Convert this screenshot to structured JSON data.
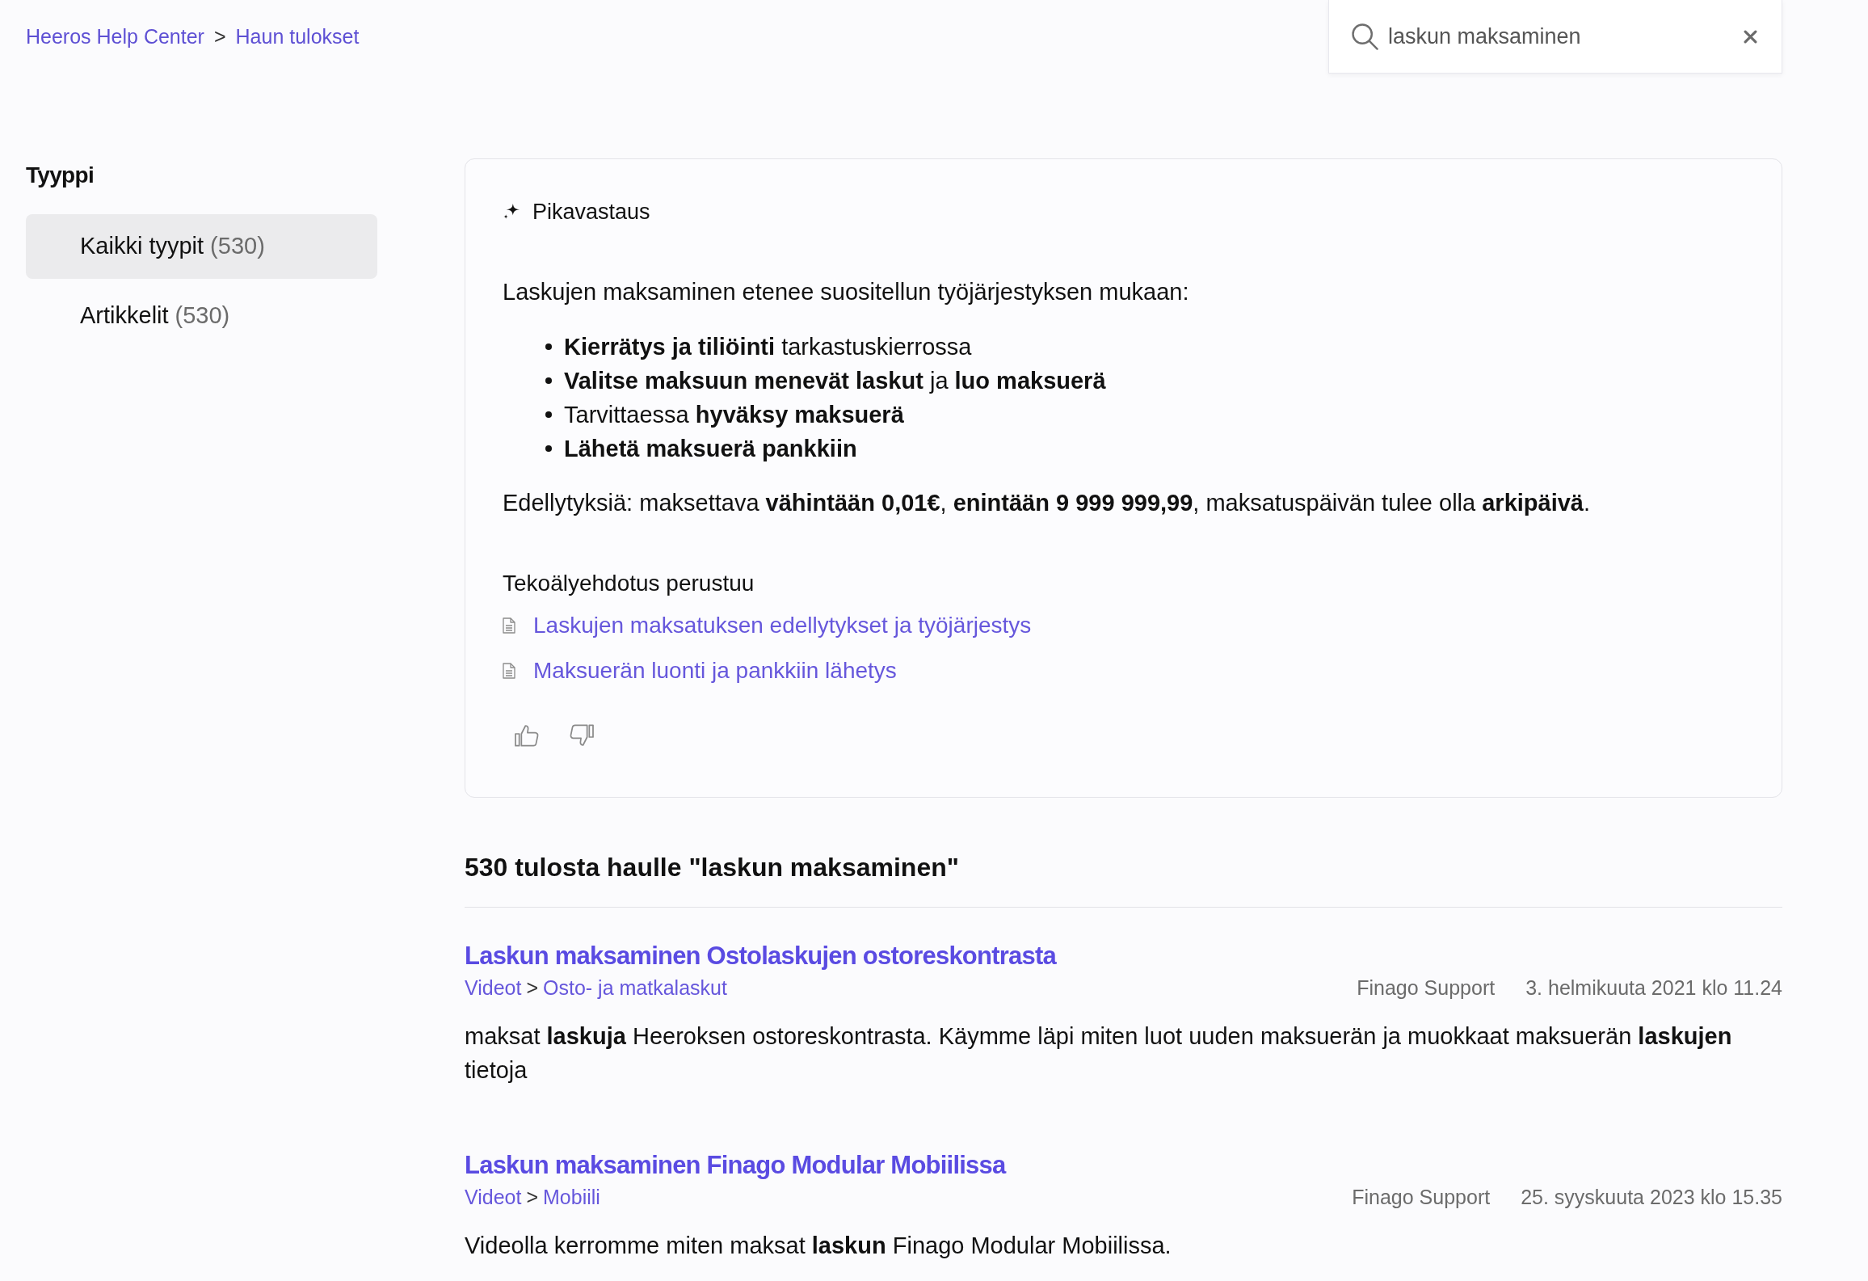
{
  "breadcrumb": {
    "items": [
      "Heeros Help Center",
      "Haun tulokset"
    ],
    "separator": ">"
  },
  "search": {
    "value": "laskun maksaminen"
  },
  "sidebar": {
    "title": "Tyyppi",
    "items": [
      {
        "label": "Kaikki tyypit",
        "count": "(530)",
        "selected": true
      },
      {
        "label": "Artikkelit",
        "count": "(530)",
        "selected": false
      }
    ]
  },
  "quick_answer": {
    "title": "Pikavastaus",
    "intro": "Laskujen maksaminen etenee suositellun työjärjestyksen mukaan:",
    "steps": [
      {
        "text": "**Kierrätys ja tiliöinti** tarkastuskierrossa",
        "emphasis": false
      },
      {
        "text": "**Valitse maksuun menevät laskut** ja **luo maksuerä**",
        "emphasis": false
      },
      {
        "text": "Tarvittaessa **hyväksy maksuerä**",
        "emphasis": false
      },
      {
        "text": "Lähetä maksuerä pankkiin",
        "emphasis": true
      }
    ],
    "conditions": "Edellytyksiä: maksettava **vähintään 0,01€**, **enintään 9 999 999,99**, maksatuspäivän tulee olla **arkipäivä**.",
    "sources_label": "Tekoälyehdotus perustuu",
    "sources": [
      "Laskujen maksatuksen edellytykset ja työjärjestys",
      "Maksuerän luonti ja pankkiin lähetys"
    ]
  },
  "results": {
    "heading": "530 tulosta haulle \"laskun maksaminen\"",
    "items": [
      {
        "title": "Laskun maksaminen Ostolaskujen ostoreskontrasta",
        "path": [
          "Videot",
          "Osto- ja matkalaskut"
        ],
        "path_separator": ">",
        "author": "Finago Support",
        "date": "3. helmikuuta 2021 klo 11.24",
        "snippet": "maksat **laskuja** Heeroksen ostoreskontrasta. Käymme läpi miten luot uuden maksuerän ja muokkaat maksuerän **laskujen** tietoja"
      },
      {
        "title": "Laskun maksaminen Finago Modular Mobiilissa",
        "path": [
          "Videot",
          "Mobiili"
        ],
        "path_separator": ">",
        "author": "Finago Support",
        "date": "25. syyskuuta 2023 klo 15.35",
        "snippet": "Videolla kerromme miten maksat **laskun** Finago Modular Mobiilissa."
      }
    ]
  }
}
